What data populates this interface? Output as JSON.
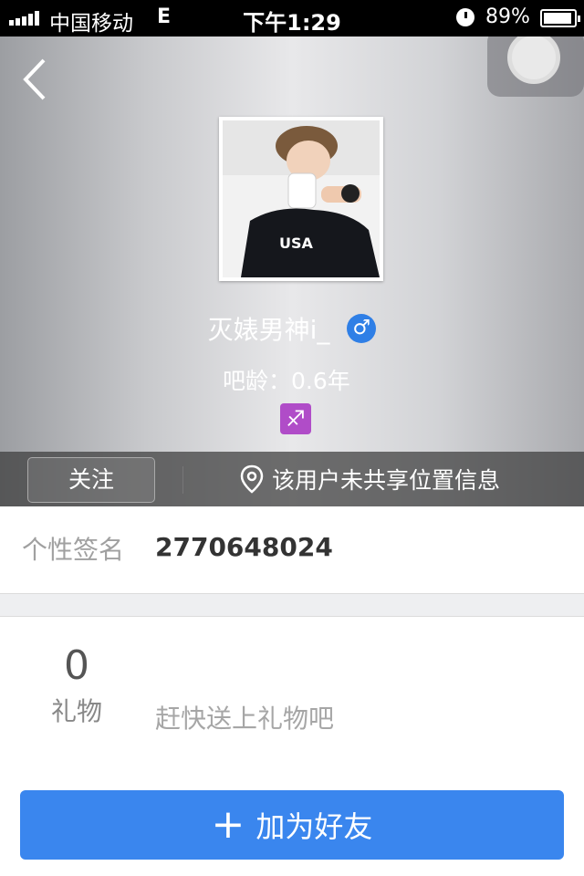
{
  "status_bar": {
    "carrier": "中国移动",
    "network": "E",
    "time": "下午1:29",
    "battery": "89%"
  },
  "profile": {
    "username": "灭婊男神i_",
    "gender_icon": "male-icon",
    "gender_symbol": "♂",
    "age_label": "吧龄：0.6年",
    "zodiac_icon": "sagittarius-icon",
    "zodiac_symbol": "♐",
    "avatar_shirt_text": "USA"
  },
  "actions": {
    "follow_label": "关注",
    "location_text": "该用户未共享位置信息"
  },
  "signature": {
    "label": "个性签名",
    "value": "2770648024"
  },
  "gift": {
    "count": "0",
    "label": "礼物",
    "hint": "赶快送上礼物吧"
  },
  "add_friend": {
    "plus": "+",
    "label": "加为好友"
  },
  "colors": {
    "accent": "#3a86ee",
    "male_badge": "#2f7fe6",
    "zodiac_badge": "#b04cc8"
  }
}
